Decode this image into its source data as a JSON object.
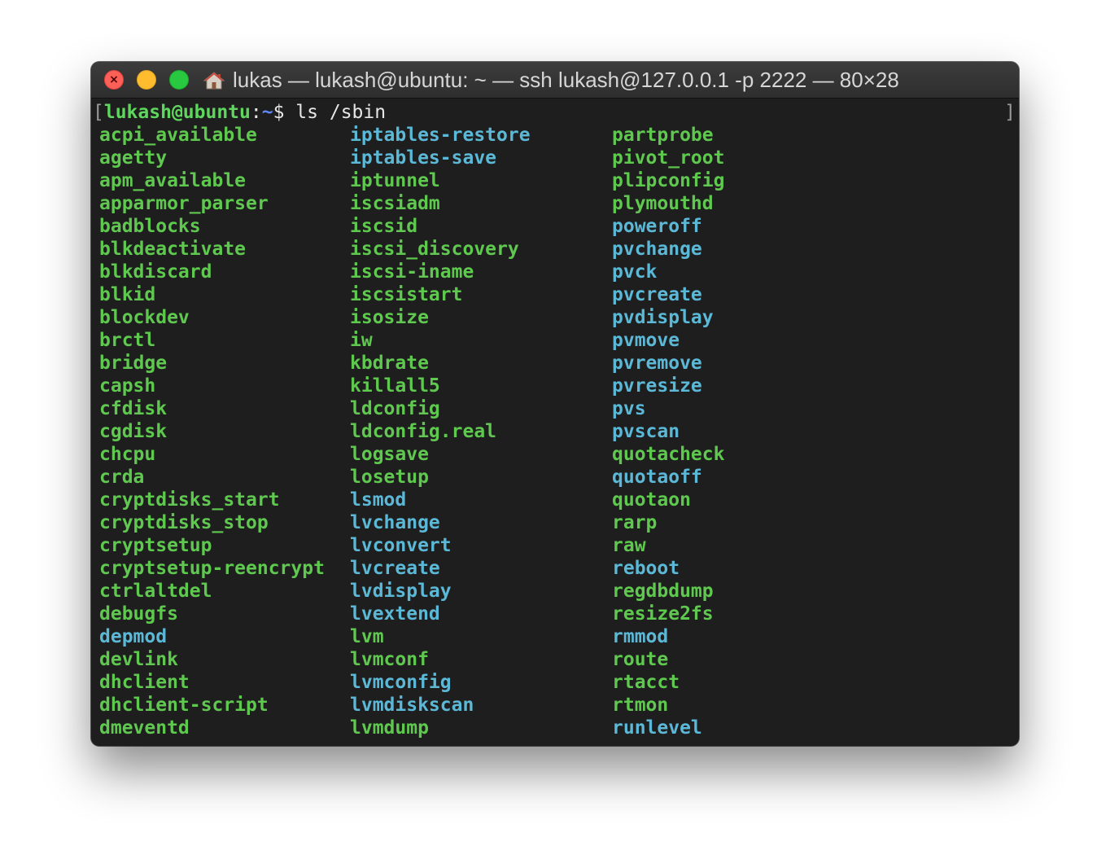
{
  "window": {
    "title": "lukas — lukash@ubuntu: ~ — ssh lukash@127.0.0.1 -p 2222 — 80×28",
    "close_glyph": "×"
  },
  "prompt": {
    "open_bracket": "[",
    "user_host": "lukash@ubuntu",
    "colon": ":",
    "path": "~",
    "symbol": "$",
    "command": " ls /sbin",
    "close_bracket": "]"
  },
  "colors": {
    "executable": "#5fc84f",
    "symlink": "#5bb8d6",
    "prompt_user": "#5fd75f",
    "prompt_path": "#5f87ff",
    "background": "#1e1e1e"
  },
  "listing": {
    "columns": [
      [
        {
          "name": "acpi_available",
          "kind": "executable"
        },
        {
          "name": "agetty",
          "kind": "executable"
        },
        {
          "name": "apm_available",
          "kind": "executable"
        },
        {
          "name": "apparmor_parser",
          "kind": "executable"
        },
        {
          "name": "badblocks",
          "kind": "executable"
        },
        {
          "name": "blkdeactivate",
          "kind": "executable"
        },
        {
          "name": "blkdiscard",
          "kind": "executable"
        },
        {
          "name": "blkid",
          "kind": "executable"
        },
        {
          "name": "blockdev",
          "kind": "executable"
        },
        {
          "name": "brctl",
          "kind": "executable"
        },
        {
          "name": "bridge",
          "kind": "executable"
        },
        {
          "name": "capsh",
          "kind": "executable"
        },
        {
          "name": "cfdisk",
          "kind": "executable"
        },
        {
          "name": "cgdisk",
          "kind": "executable"
        },
        {
          "name": "chcpu",
          "kind": "executable"
        },
        {
          "name": "crda",
          "kind": "executable"
        },
        {
          "name": "cryptdisks_start",
          "kind": "executable"
        },
        {
          "name": "cryptdisks_stop",
          "kind": "executable"
        },
        {
          "name": "cryptsetup",
          "kind": "executable"
        },
        {
          "name": "cryptsetup-reencrypt",
          "kind": "executable"
        },
        {
          "name": "ctrlaltdel",
          "kind": "executable"
        },
        {
          "name": "debugfs",
          "kind": "executable"
        },
        {
          "name": "depmod",
          "kind": "symlink"
        },
        {
          "name": "devlink",
          "kind": "executable"
        },
        {
          "name": "dhclient",
          "kind": "executable"
        },
        {
          "name": "dhclient-script",
          "kind": "executable"
        },
        {
          "name": "dmeventd",
          "kind": "executable"
        }
      ],
      [
        {
          "name": "iptables-restore",
          "kind": "symlink"
        },
        {
          "name": "iptables-save",
          "kind": "symlink"
        },
        {
          "name": "iptunnel",
          "kind": "executable"
        },
        {
          "name": "iscsiadm",
          "kind": "executable"
        },
        {
          "name": "iscsid",
          "kind": "executable"
        },
        {
          "name": "iscsi_discovery",
          "kind": "executable"
        },
        {
          "name": "iscsi-iname",
          "kind": "executable"
        },
        {
          "name": "iscsistart",
          "kind": "executable"
        },
        {
          "name": "isosize",
          "kind": "executable"
        },
        {
          "name": "iw",
          "kind": "executable"
        },
        {
          "name": "kbdrate",
          "kind": "executable"
        },
        {
          "name": "killall5",
          "kind": "executable"
        },
        {
          "name": "ldconfig",
          "kind": "executable"
        },
        {
          "name": "ldconfig.real",
          "kind": "executable"
        },
        {
          "name": "logsave",
          "kind": "executable"
        },
        {
          "name": "losetup",
          "kind": "executable"
        },
        {
          "name": "lsmod",
          "kind": "symlink"
        },
        {
          "name": "lvchange",
          "kind": "symlink"
        },
        {
          "name": "lvconvert",
          "kind": "symlink"
        },
        {
          "name": "lvcreate",
          "kind": "symlink"
        },
        {
          "name": "lvdisplay",
          "kind": "symlink"
        },
        {
          "name": "lvextend",
          "kind": "symlink"
        },
        {
          "name": "lvm",
          "kind": "executable"
        },
        {
          "name": "lvmconf",
          "kind": "executable"
        },
        {
          "name": "lvmconfig",
          "kind": "symlink"
        },
        {
          "name": "lvmdiskscan",
          "kind": "symlink"
        },
        {
          "name": "lvmdump",
          "kind": "executable"
        }
      ],
      [
        {
          "name": "partprobe",
          "kind": "executable"
        },
        {
          "name": "pivot_root",
          "kind": "executable"
        },
        {
          "name": "plipconfig",
          "kind": "executable"
        },
        {
          "name": "plymouthd",
          "kind": "executable"
        },
        {
          "name": "poweroff",
          "kind": "symlink"
        },
        {
          "name": "pvchange",
          "kind": "symlink"
        },
        {
          "name": "pvck",
          "kind": "symlink"
        },
        {
          "name": "pvcreate",
          "kind": "symlink"
        },
        {
          "name": "pvdisplay",
          "kind": "symlink"
        },
        {
          "name": "pvmove",
          "kind": "symlink"
        },
        {
          "name": "pvremove",
          "kind": "symlink"
        },
        {
          "name": "pvresize",
          "kind": "symlink"
        },
        {
          "name": "pvs",
          "kind": "symlink"
        },
        {
          "name": "pvscan",
          "kind": "symlink"
        },
        {
          "name": "quotacheck",
          "kind": "executable"
        },
        {
          "name": "quotaoff",
          "kind": "symlink"
        },
        {
          "name": "quotaon",
          "kind": "executable"
        },
        {
          "name": "rarp",
          "kind": "executable"
        },
        {
          "name": "raw",
          "kind": "executable"
        },
        {
          "name": "reboot",
          "kind": "symlink"
        },
        {
          "name": "regdbdump",
          "kind": "executable"
        },
        {
          "name": "resize2fs",
          "kind": "executable"
        },
        {
          "name": "rmmod",
          "kind": "symlink"
        },
        {
          "name": "route",
          "kind": "executable"
        },
        {
          "name": "rtacct",
          "kind": "executable"
        },
        {
          "name": "rtmon",
          "kind": "executable"
        },
        {
          "name": "runlevel",
          "kind": "symlink"
        }
      ]
    ]
  }
}
